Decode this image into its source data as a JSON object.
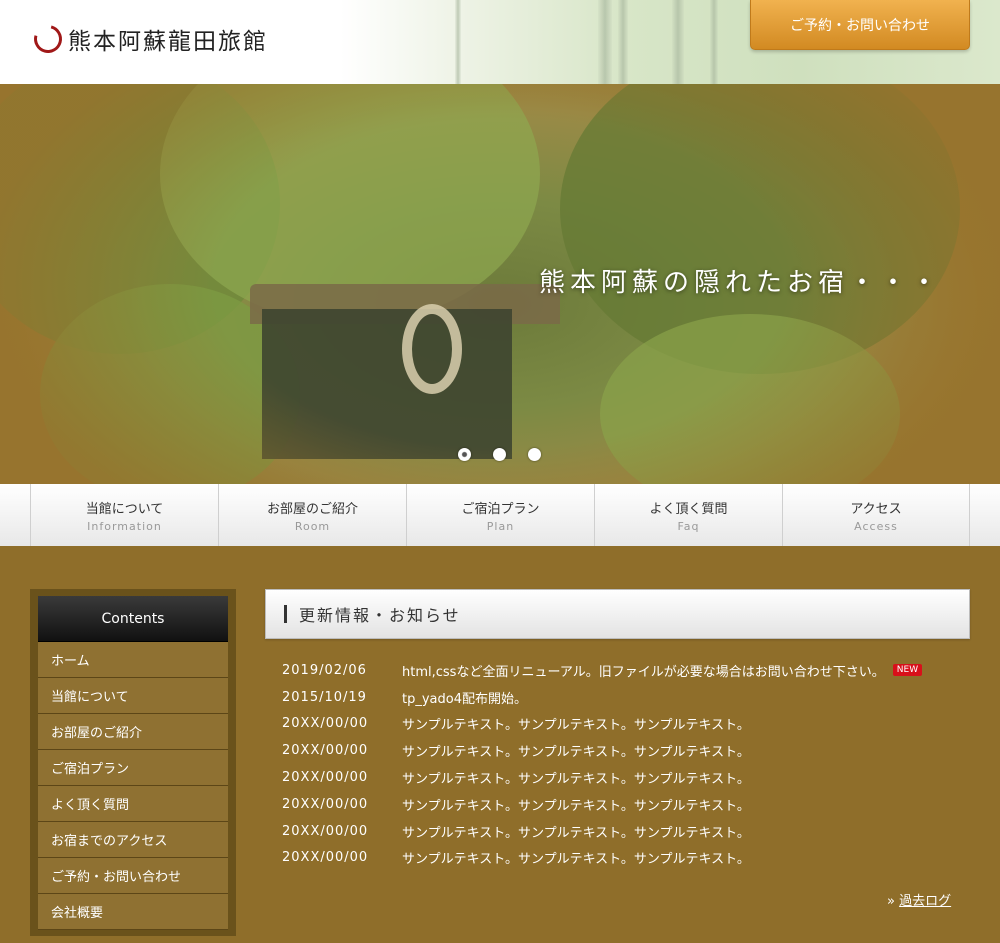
{
  "header": {
    "logo_text": "熊本阿蘇龍田旅館",
    "contact_button": "ご予約・お問い合わせ"
  },
  "hero": {
    "caption": "熊本阿蘇の隠れたお宿・・・",
    "slides": 3,
    "active_slide": 1
  },
  "nav": {
    "items": [
      {
        "ja": "当館について",
        "en": "Information"
      },
      {
        "ja": "お部屋のご紹介",
        "en": "Room"
      },
      {
        "ja": "ご宿泊プラン",
        "en": "Plan"
      },
      {
        "ja": "よく頂く質問",
        "en": "Faq"
      },
      {
        "ja": "アクセス",
        "en": "Access"
      }
    ]
  },
  "sidebar": {
    "title": "Contents",
    "items": [
      "ホーム",
      "当館について",
      "お部屋のご紹介",
      "ご宿泊プラン",
      "よく頂く質問",
      "お宿までのアクセス",
      "ご予約・お問い合わせ",
      "会社概要"
    ]
  },
  "news": {
    "title": "更新情報・お知らせ",
    "new_badge": "NEW",
    "items": [
      {
        "date": "2019/02/06",
        "text": "html,cssなど全面リニューアル。旧ファイルが必要な場合はお問い合わせ下さい。"
      },
      {
        "date": "2015/10/19",
        "text": "tp_yado4配布開始。"
      },
      {
        "date": "20XX/00/00",
        "text": "サンプルテキスト。サンプルテキスト。サンプルテキスト。"
      },
      {
        "date": "20XX/00/00",
        "text": "サンプルテキスト。サンプルテキスト。サンプルテキスト。"
      },
      {
        "date": "20XX/00/00",
        "text": "サンプルテキスト。サンプルテキスト。サンプルテキスト。"
      },
      {
        "date": "20XX/00/00",
        "text": "サンプルテキスト。サンプルテキスト。サンプルテキスト。"
      },
      {
        "date": "20XX/00/00",
        "text": "サンプルテキスト。サンプルテキスト。サンプルテキスト。"
      },
      {
        "date": "20XX/00/00",
        "text": "サンプルテキスト。サンプルテキスト。サンプルテキスト。"
      }
    ],
    "past_log_prefix": "»",
    "past_log_label": "過去ログ"
  }
}
